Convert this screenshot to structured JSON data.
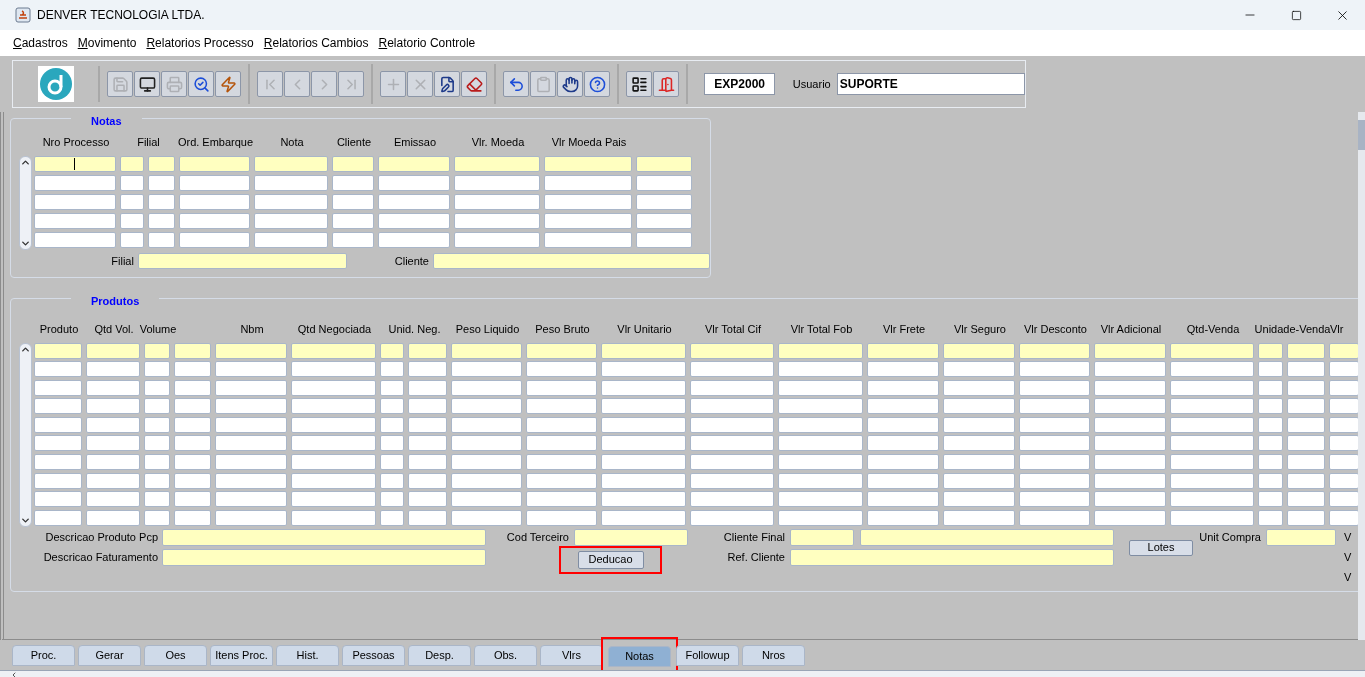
{
  "window": {
    "title": "DENVER TECNOLOGIA LTDA."
  },
  "menu": [
    "Cadastros",
    "Movimento",
    "Relatorios Processo",
    "Relatorios Cambios",
    "Relatorio Controle"
  ],
  "toolbar": {
    "groups": [
      [
        {
          "kind": "save",
          "disabled": true
        },
        {
          "kind": "window",
          "disabled": false
        },
        {
          "kind": "print",
          "disabled": true
        },
        {
          "kind": "query",
          "disabled": false
        },
        {
          "kind": "execute",
          "disabled": false
        }
      ],
      [
        {
          "kind": "first",
          "disabled": true
        },
        {
          "kind": "previous",
          "disabled": true
        },
        {
          "kind": "next",
          "disabled": true
        },
        {
          "kind": "last",
          "disabled": true
        }
      ],
      [
        {
          "kind": "insert",
          "disabled": true
        },
        {
          "kind": "delete",
          "disabled": true
        },
        {
          "kind": "edit",
          "disabled": false
        },
        {
          "kind": "clear",
          "disabled": false
        }
      ],
      [
        {
          "kind": "undo",
          "disabled": false
        },
        {
          "kind": "paste",
          "disabled": true
        },
        {
          "kind": "hand",
          "disabled": false
        },
        {
          "kind": "help",
          "disabled": false
        }
      ],
      [
        {
          "kind": "menu",
          "disabled": false
        },
        {
          "kind": "exit",
          "disabled": false
        }
      ]
    ],
    "module": "EXP2000",
    "user_label": "Usuario",
    "user_value": "SUPORTE"
  },
  "notas": {
    "title": "Notas",
    "columns": [
      "Nro Processo",
      "Filial",
      "Ord. Embarque",
      "Nota",
      "Cliente",
      "Emissao",
      "Vlr. Moeda",
      "Vlr Moeda Pais"
    ],
    "records": [
      {
        "selected": true
      },
      {
        "selected": false
      },
      {
        "selected": false
      },
      {
        "selected": false
      },
      {
        "selected": false
      }
    ],
    "filial_label": "Filial",
    "cliente_label": "Cliente"
  },
  "produtos": {
    "title": "Produtos",
    "columns": [
      "Produto",
      "Qtd Vol.",
      "Volume",
      "Nbm",
      "Qtd Negociada",
      "Unid. Neg.",
      "Peso Liquido",
      "Peso Bruto",
      "Vlr Unitario",
      "Vlr Total Cif",
      "Vlr Total Fob",
      "Vlr Frete",
      "Vlr Seguro",
      "Vlr Desconto",
      "Vlr Adicional",
      "Qtd-Venda",
      "Unidade-Venda",
      "Vlr"
    ],
    "records": [
      {
        "selected": true
      },
      {
        "selected": false
      },
      {
        "selected": false
      },
      {
        "selected": false
      },
      {
        "selected": false
      },
      {
        "selected": false
      },
      {
        "selected": false
      },
      {
        "selected": false
      },
      {
        "selected": false
      },
      {
        "selected": false
      }
    ],
    "labels": [
      "Descricao Produto Pcp",
      "Descricao Faturamento",
      "Cod Terceiro",
      "Cliente Final",
      "Ref. Cliente",
      "Unit Compra"
    ],
    "buttons": [
      {
        "label": "Deducao",
        "highlighted": true
      },
      {
        "label": "Lotes",
        "highlighted": false
      }
    ],
    "right_labels": [
      "V",
      "V",
      "V"
    ]
  },
  "tabs": [
    {
      "label": "Proc.",
      "selected": false,
      "highlighted": false
    },
    {
      "label": "Gerar",
      "selected": false,
      "highlighted": false
    },
    {
      "label": "Oes",
      "selected": false,
      "highlighted": false
    },
    {
      "label": "Itens Proc.",
      "selected": false,
      "highlighted": false
    },
    {
      "label": "Hist.",
      "selected": false,
      "highlighted": false
    },
    {
      "label": "Pessoas",
      "selected": false,
      "highlighted": false
    },
    {
      "label": "Desp.",
      "selected": false,
      "highlighted": false
    },
    {
      "label": "Obs.",
      "selected": false,
      "highlighted": false
    },
    {
      "label": "Vlrs",
      "selected": false,
      "highlighted": false
    },
    {
      "label": "Notas",
      "selected": true,
      "highlighted": true
    },
    {
      "label": "Followup",
      "selected": false,
      "highlighted": false
    },
    {
      "label": "Nros",
      "selected": false,
      "highlighted": false
    }
  ]
}
